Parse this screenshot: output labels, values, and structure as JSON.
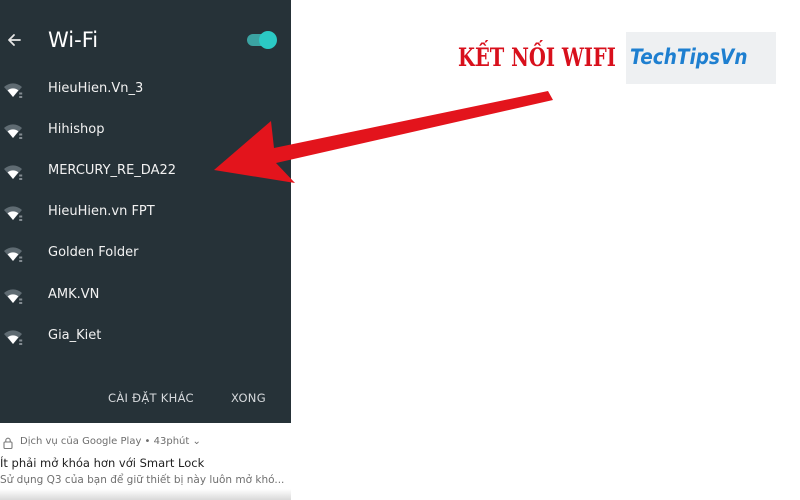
{
  "wifi_panel": {
    "title": "Wi-Fi",
    "back_icon": "arrow-left-icon",
    "toggle": {
      "state": "on",
      "color": "#2bc9c4"
    },
    "networks": [
      {
        "ssid": "HieuHien.Vn_3",
        "icon": "wifi-signal-icon"
      },
      {
        "ssid": "Hihishop",
        "icon": "wifi-signal-icon"
      },
      {
        "ssid": "MERCURY_RE_DA22",
        "icon": "wifi-signal-icon"
      },
      {
        "ssid": "HieuHien.vn FPT",
        "icon": "wifi-signal-icon"
      },
      {
        "ssid": "Golden Folder",
        "icon": "wifi-signal-icon"
      },
      {
        "ssid": "AMK.VN",
        "icon": "wifi-signal-icon"
      },
      {
        "ssid": "Gia_Kiet",
        "icon": "wifi-signal-icon"
      }
    ],
    "other_settings_label": "CÀI ĐẶT KHÁC",
    "done_label": "XONG",
    "background_color": "#263238"
  },
  "notification": {
    "source": "Dịch vụ của Google Play • 43phút ⌄",
    "title": "Ít phải mở khóa hơn với Smart Lock",
    "body": "Sử dụng Q3 của bạn để giữ thiết bị này luôn mở khó...",
    "icon": "lock-icon"
  },
  "annotation": {
    "headline": "KẾT NỐI WIFI",
    "headline_color": "#d8101c",
    "arrow_color": "#e3141c"
  },
  "brand": {
    "logo_text": "TechTipsVn",
    "logo_color": "#1e7fd0"
  }
}
